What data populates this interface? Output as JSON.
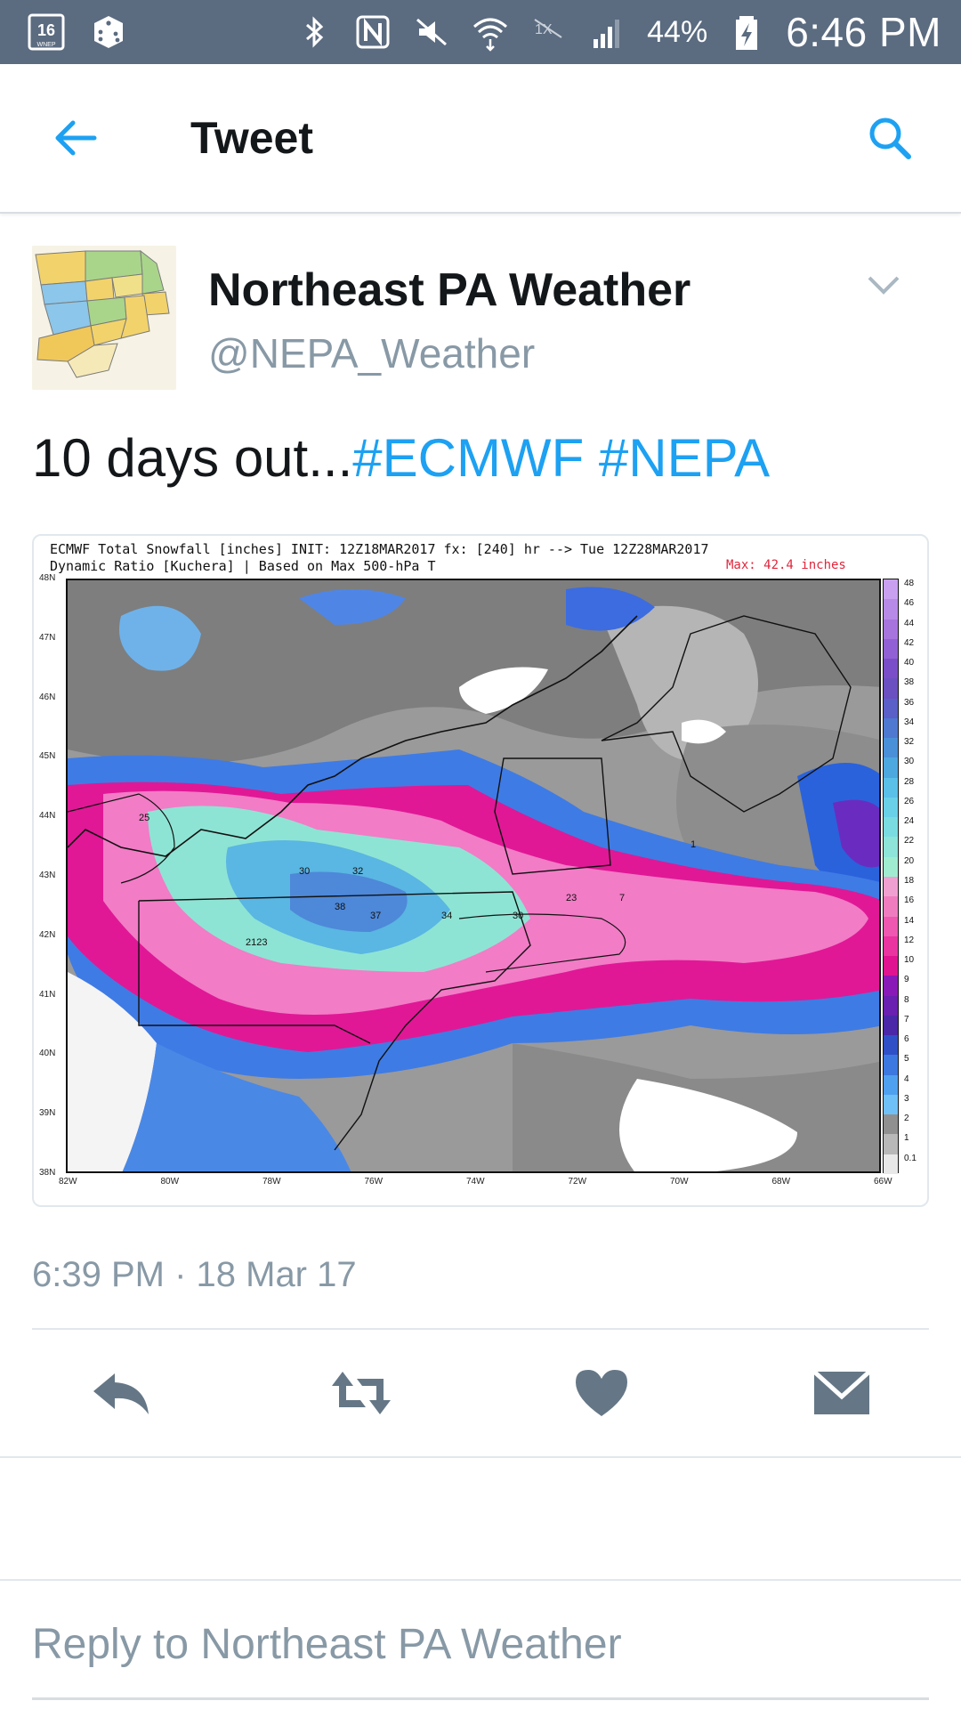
{
  "status_bar": {
    "channel_badge": "16",
    "channel_sub": "WNEP",
    "battery": "44%",
    "time": "6:46 PM",
    "icons": [
      "wnep-app-icon",
      "dice-icon",
      "bluetooth-icon",
      "nfc-icon",
      "mute-icon",
      "wifi-icon",
      "no-data-icon",
      "signal-icon",
      "battery-icon"
    ]
  },
  "header": {
    "title": "Tweet",
    "back_icon": "back-arrow-icon",
    "search_icon": "search-icon"
  },
  "tweet": {
    "author_name": "Northeast PA Weather",
    "author_handle": "@NEPA_Weather",
    "text_plain": "10 days out...",
    "hashtags": [
      "#ECMWF",
      "#NEPA"
    ],
    "timestamp": "6:39 PM · 18 Mar 17"
  },
  "map": {
    "title_line1": "ECMWF Total Snowfall [inches] INIT: 12Z18MAR2017 fx: [240] hr --> Tue 12Z28MAR2017",
    "title_line2": "Dynamic Ratio [Kuchera] | Based on Max 500-hPa T",
    "max_label": "Max: 42.4 inches",
    "lat_labels": [
      "48N",
      "47N",
      "46N",
      "45N",
      "44N",
      "43N",
      "42N",
      "41N",
      "40N",
      "39N",
      "38N"
    ],
    "lon_labels": [
      "82W",
      "80W",
      "78W",
      "76W",
      "74W",
      "72W",
      "70W",
      "68W",
      "66W"
    ],
    "colorbar_labels": [
      "48",
      "46",
      "44",
      "42",
      "40",
      "38",
      "36",
      "34",
      "32",
      "30",
      "28",
      "26",
      "24",
      "22",
      "20",
      "18",
      "16",
      "14",
      "12",
      "10",
      "9",
      "8",
      "7",
      "6",
      "5",
      "4",
      "3",
      "2",
      "1",
      "0.1"
    ],
    "colorbar_colors": [
      "#c9a0f0",
      "#b88ae8",
      "#a774de",
      "#9160d4",
      "#7a4ec8",
      "#6a50c0",
      "#5a60c8",
      "#4f78d0",
      "#4a90d8",
      "#4ea8e0",
      "#5ac0e8",
      "#6ad0e8",
      "#7adce0",
      "#8ee4d8",
      "#a0ecd0",
      "#f0a0d0",
      "#f07cc0",
      "#ee58b0",
      "#ea34a0",
      "#e01490",
      "#8a1ab8",
      "#6a20b0",
      "#4a28a8",
      "#3050c8",
      "#3c78e0",
      "#50a0f0",
      "#70c0f8",
      "#909090",
      "#b8b8b8",
      "#e8e8e8"
    ]
  },
  "actions": {
    "reply_icon": "reply-icon",
    "retweet_icon": "retweet-icon",
    "like_icon": "heart-icon",
    "dm_icon": "envelope-icon"
  },
  "reply": {
    "placeholder": "Reply to Northeast PA Weather"
  },
  "colors": {
    "status_bar_bg": "#5b6b80",
    "accent": "#1da1f2",
    "secondary_text": "#8899a6",
    "action_icon": "#657786"
  }
}
